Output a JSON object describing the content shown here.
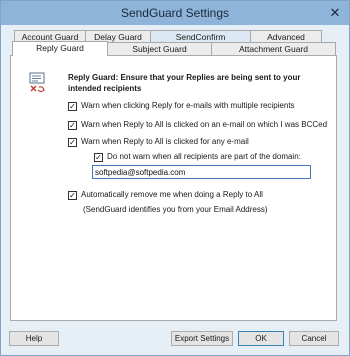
{
  "window": {
    "title": "SendGuard Settings",
    "close_glyph": "✕"
  },
  "tabs_back": [
    {
      "label": "Account Guard"
    },
    {
      "label": "Delay Guard"
    },
    {
      "label": "SendConfirm"
    },
    {
      "label": "Advanced"
    }
  ],
  "tabs_front": [
    {
      "label": "Reply Guard",
      "active": true
    },
    {
      "label": "Subject Guard"
    },
    {
      "label": "Attachment Guard"
    }
  ],
  "reply_guard": {
    "icon": "reply-guard-icon",
    "header": "Reply Guard: Ensure that your Replies are being sent to your intended recipients",
    "options": [
      {
        "label": "Warn when clicking Reply for e-mails with multiple recipients",
        "checked": true
      },
      {
        "label": "Warn when Reply to All is clicked on an e-mail on which I was BCCed",
        "checked": true
      },
      {
        "label": "Warn when Reply to All is clicked for any e-mail",
        "checked": true
      },
      {
        "label": "Do not warn when all recipients are part of the domain:",
        "checked": true
      },
      {
        "label": "Automatically remove me when doing a Reply to All",
        "checked": true
      }
    ],
    "domain_value": "softpedia@softpedia.com",
    "note": "(SendGuard identifies you from your Email Address)"
  },
  "buttons": {
    "help": "Help",
    "export": "Export Settings",
    "ok": "OK",
    "cancel": "Cancel"
  }
}
